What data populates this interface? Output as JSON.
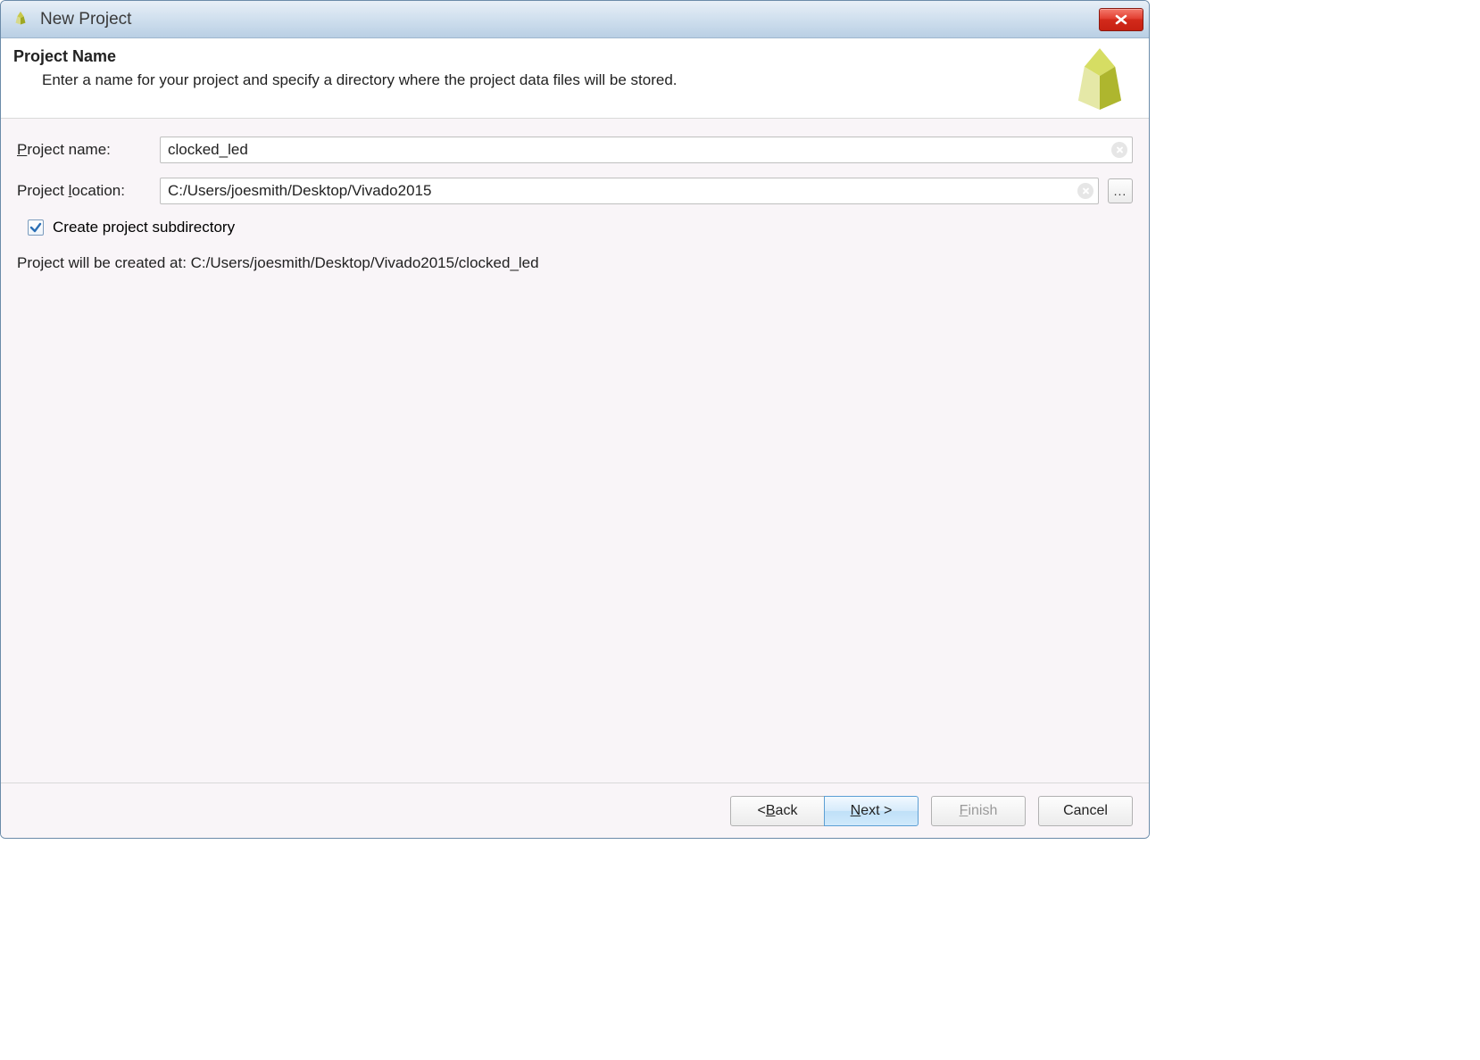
{
  "window": {
    "title": "New Project"
  },
  "header": {
    "title": "Project Name",
    "description": "Enter a name for your project and specify a directory where the project data files will be stored."
  },
  "form": {
    "project_name_label_pre": "P",
    "project_name_label_post": "roject name:",
    "project_name_value": "clocked_led",
    "project_location_label_pre": "Project ",
    "project_location_label_u": "l",
    "project_location_label_post": "ocation:",
    "project_location_value": "C:/Users/joesmith/Desktop/Vivado2015",
    "browse_label": "...",
    "subdir_checkbox_label": "Create project subdirectory",
    "subdir_checked": true,
    "summary_text": "Project will be created at: C:/Users/joesmith/Desktop/Vivado2015/clocked_led"
  },
  "footer": {
    "back_pre": "< ",
    "back_u": "B",
    "back_post": "ack",
    "next_u": "N",
    "next_post": "ext >",
    "finish_u": "F",
    "finish_post": "inish",
    "cancel": "Cancel"
  }
}
